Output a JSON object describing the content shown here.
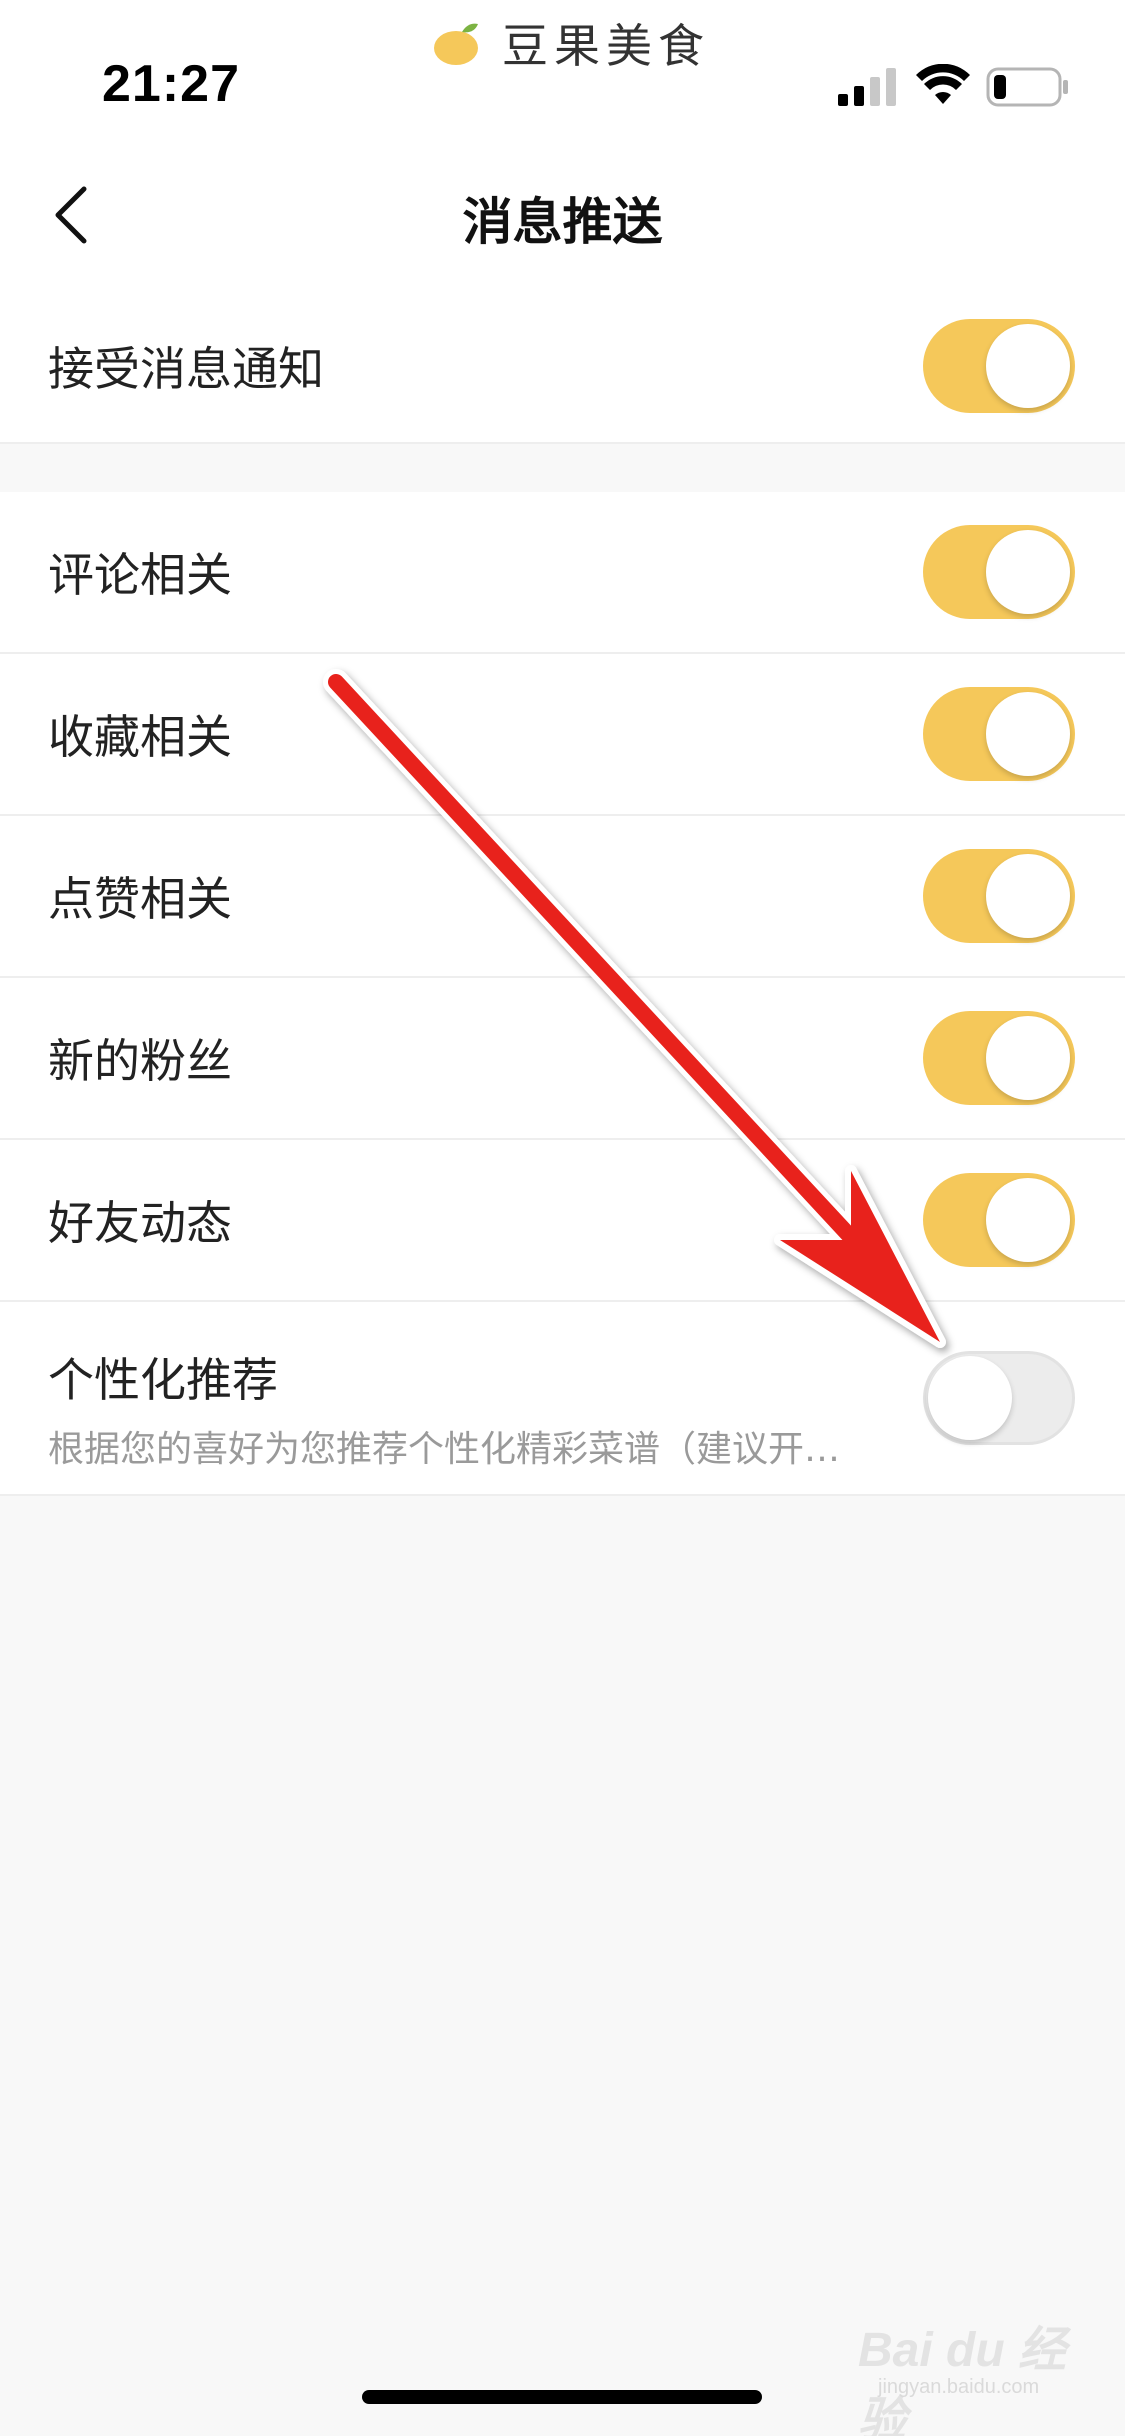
{
  "status_bar": {
    "time": "21:27",
    "app_brand": "豆果美食",
    "battery_level": 0.2
  },
  "nav": {
    "title": "消息推送"
  },
  "master": {
    "label": "接受消息通知",
    "on": true
  },
  "settings": [
    {
      "label": "评论相关",
      "on": true
    },
    {
      "label": "收藏相关",
      "on": true
    },
    {
      "label": "点赞相关",
      "on": true
    },
    {
      "label": "新的粉丝",
      "on": true
    },
    {
      "label": "好友动态",
      "on": true
    }
  ],
  "personalized": {
    "label": "个性化推荐",
    "description": "根据您的喜好为您推荐个性化精彩菜谱（建议开…",
    "on": false
  },
  "colors": {
    "toggle_on": "#f5c85a",
    "toggle_off": "#ececec",
    "arrow": "#e8201a",
    "background": "#f8f8f8"
  },
  "watermark": {
    "main": "Bai du 经验",
    "sub": "jingyan.baidu.com"
  }
}
